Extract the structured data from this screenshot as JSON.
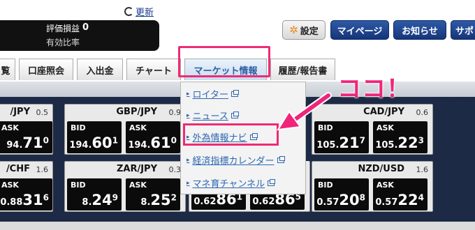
{
  "header": {
    "refresh_label": "更新",
    "account": {
      "pl_label": "評価損益",
      "pl_value": "0",
      "ratio_label": "有効比率"
    },
    "buttons": {
      "settings": "設定",
      "mypage": "マイページ",
      "notice": "お知らせ",
      "support": "サポ"
    }
  },
  "nav": {
    "tabs": [
      "覧",
      "口座照会",
      "入出金",
      "チャート",
      "マーケット情報",
      "履歴/報告書"
    ]
  },
  "annotation": "ココ！",
  "dropdown": {
    "items": [
      "ロイター",
      "ニュース",
      "外為情報ナビ",
      "経済指標カレンダー",
      "マネ育チャンネル"
    ],
    "highlighted": "外為情報ナビ"
  },
  "rates": {
    "usdjpy": {
      "pair": "/JPY",
      "spread": "0.5",
      "ask_label": "ASK",
      "ask": [
        "94.",
        "71",
        "0"
      ]
    },
    "gbpjpy": {
      "pair": "GBP/JPY",
      "spread": "0.9",
      "bid_label": "BID",
      "bid": [
        "194.",
        "60",
        "1"
      ],
      "ask_label": "ASK",
      "ask": [
        "194.",
        "61",
        "0"
      ]
    },
    "cadjpy": {
      "pair": "CAD/JPY",
      "spread": "0.6",
      "bid_label": "BID",
      "bid": [
        "105.",
        "21",
        "7"
      ],
      "ask_label": "ASK",
      "ask": [
        "105.",
        "22",
        "3"
      ]
    },
    "usdchf": {
      "pair": "/CHF",
      "spread": "1.6",
      "ask_label": "ASK",
      "ask": [
        "0.88",
        "31",
        "6"
      ]
    },
    "zarjpy": {
      "pair": "ZAR/JPY",
      "spread": "0.3",
      "bid_label": "BID",
      "bid": [
        "8.",
        "24",
        "9"
      ],
      "ask_label": "ASK",
      "ask": [
        "8.",
        "25",
        "2"
      ]
    },
    "middle": {
      "bid": [
        "0.62",
        "86",
        "1"
      ],
      "ask": [
        "0.62",
        "86",
        "5"
      ]
    },
    "nzdusd": {
      "pair": "NZD/USD",
      "spread": "1.6",
      "bid_label": "BID",
      "bid": [
        "0.57",
        "20",
        "8"
      ],
      "ask_label": "ASK",
      "ask": [
        "0.57",
        "22",
        "4"
      ]
    }
  },
  "colors": {
    "highlight": "#ee2b74",
    "link": "#2b67b3",
    "button_blue": "#16357a"
  }
}
